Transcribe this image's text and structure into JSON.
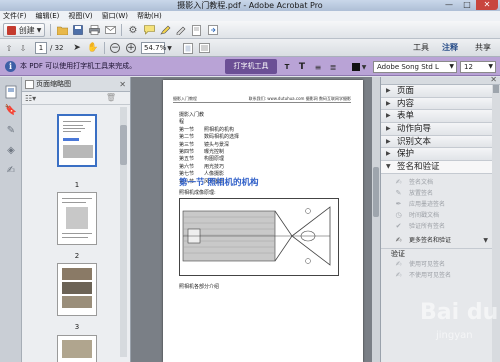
{
  "window": {
    "title": "摄影入门教程.pdf - Adobe Acrobat Pro",
    "minimize": "—",
    "maximize": "□",
    "close": "✕"
  },
  "menu": [
    "文件(F)",
    "编辑(E)",
    "视图(V)",
    "窗口(W)",
    "帮助(H)"
  ],
  "toolbar1": {
    "create_label": "创建"
  },
  "toolbar2": {
    "current_page": "1",
    "total_pages": "/ 32",
    "zoom": "54.7%",
    "tabs": [
      "工具",
      "注释",
      "共享"
    ]
  },
  "notification": {
    "message": "本 PDF 可以使用打字机工具来完成。",
    "typewriter_label": "打字机工具",
    "font": "Adobe Song Std L",
    "size": "12"
  },
  "thumbnails": {
    "title": "页面缩略图",
    "pages": [
      "1",
      "2",
      "3"
    ]
  },
  "document": {
    "runhead_left": "摄影入门教程",
    "runhead_right": "联系我们: www.dutuhua.com 摄影网  数码互联网学摄影",
    "toc": [
      {
        "ch": "摄影入门教程",
        "t": ""
      },
      {
        "ch": "第一节",
        "t": "照相机的机构"
      },
      {
        "ch": "第二节",
        "t": "数码相机的选择"
      },
      {
        "ch": "第三节",
        "t": "镜头与景深"
      },
      {
        "ch": "第四节",
        "t": "曝光控制"
      },
      {
        "ch": "第五节",
        "t": "构图原理"
      },
      {
        "ch": "第六节",
        "t": "用光技巧"
      },
      {
        "ch": "第七节",
        "t": "人像摄影"
      },
      {
        "ch": "第八节",
        "t": "风光摄影"
      }
    ],
    "section_title": "第一节 照相机的机构",
    "caption1": "照相机成像原理:",
    "caption2": "照相机各部分介绍"
  },
  "pane": {
    "sections": [
      "页面",
      "内容",
      "表单",
      "动作向导",
      "识别文本",
      "保护"
    ],
    "open_section": "签名和验证",
    "sign_tools": [
      "签名文档",
      "放置签名",
      "应用墨迹签名",
      "时间戳文档",
      "验证所有签名"
    ],
    "more_label": "更多签名和验证",
    "verify_header": "验证",
    "verify_tools": [
      "使用可见签名",
      "不使用可见签名"
    ]
  },
  "watermark": {
    "main": "Bai du",
    "sub": "jingyan"
  }
}
